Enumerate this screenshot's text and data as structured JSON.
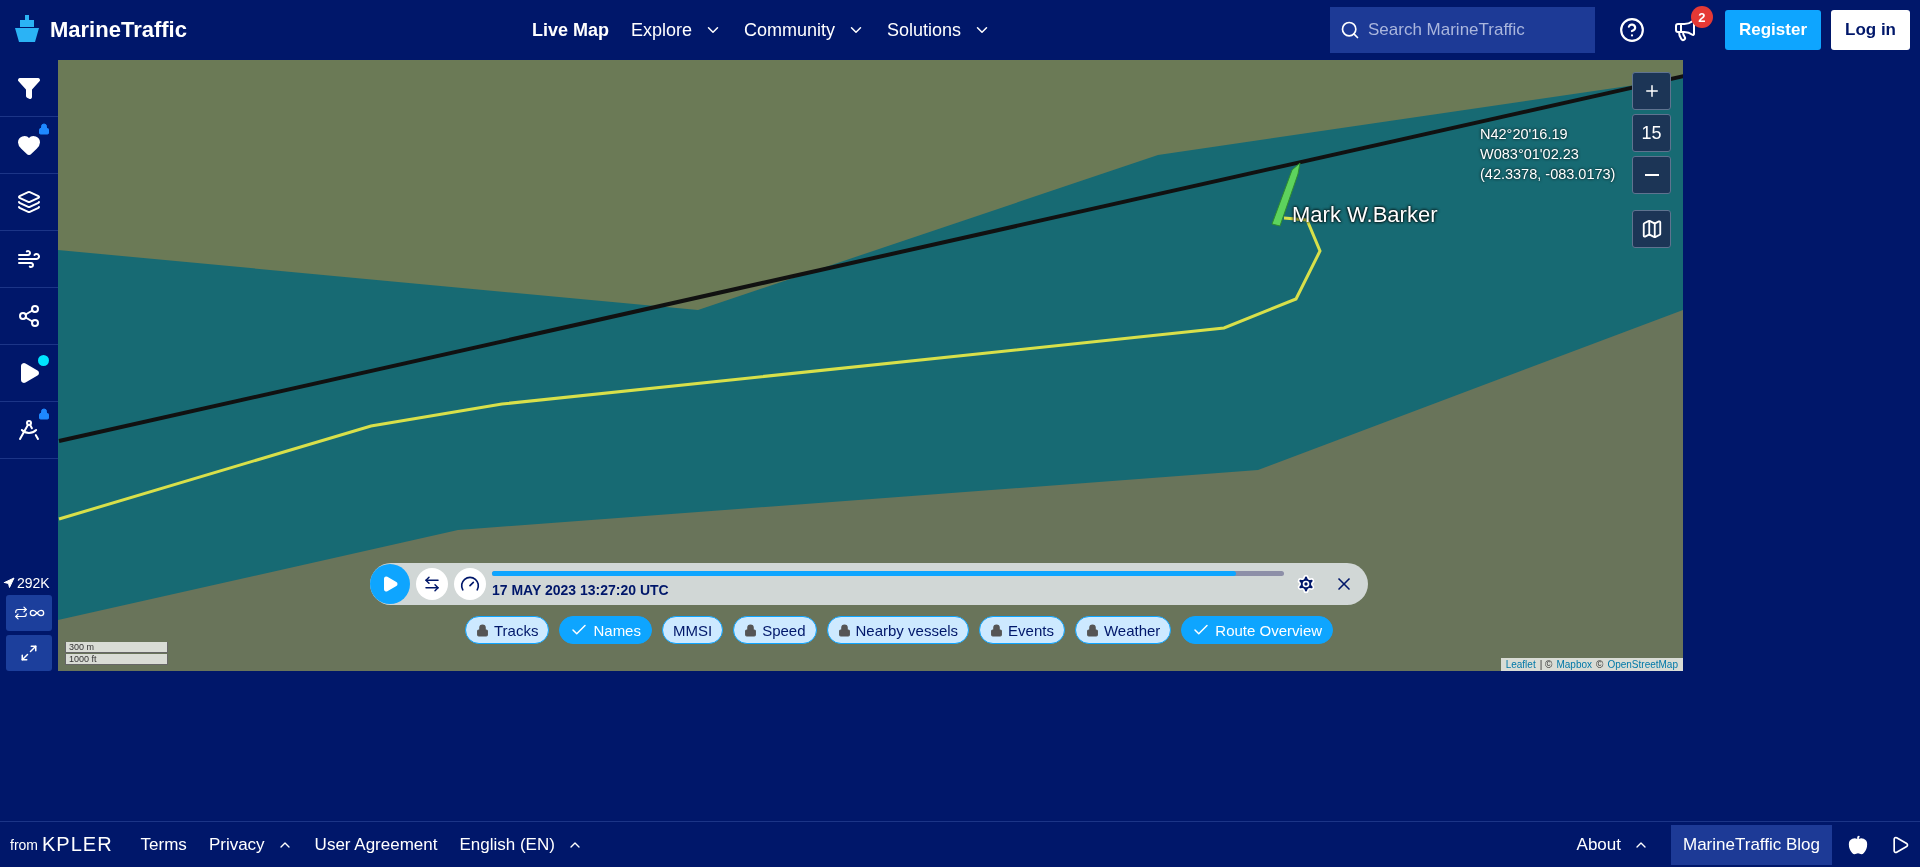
{
  "header": {
    "brand": "MarineTraffic",
    "nav": [
      {
        "label": "Live Map",
        "selected": true,
        "dropdown": false
      },
      {
        "label": "Explore",
        "selected": false,
        "dropdown": true
      },
      {
        "label": "Community",
        "selected": false,
        "dropdown": true
      },
      {
        "label": "Solutions",
        "selected": false,
        "dropdown": true
      }
    ],
    "search": {
      "placeholder": "Search MarineTraffic"
    },
    "notification_count": "2",
    "buttons": [
      {
        "label": "Register",
        "kind": "primary"
      },
      {
        "label": "Log in",
        "kind": "secondary"
      }
    ]
  },
  "sidebar": {
    "items": [
      {
        "kind": "filter",
        "locked": false,
        "notification": false
      },
      {
        "kind": "heart",
        "locked": true,
        "notification": false
      },
      {
        "kind": "layers",
        "locked": false,
        "notification": false
      },
      {
        "kind": "wind",
        "locked": false,
        "notification": false
      },
      {
        "kind": "network",
        "locked": false,
        "notification": false
      },
      {
        "kind": "play",
        "locked": false,
        "notification": true
      },
      {
        "kind": "compass",
        "locked": true,
        "notification": false
      }
    ],
    "vessel_count": "292K"
  },
  "map": {
    "vessel_name": "Mark W.Barker",
    "coordinates": [
      "N42°20'16.19",
      "W083°01'02.23",
      "(42.3378, -083.0173)"
    ],
    "zoom_level": "15",
    "scale": [
      "300 m",
      "1000 ft"
    ],
    "attribution": [
      {
        "kind": "link",
        "text": "Leaflet"
      },
      {
        "kind": "separator",
        "text": "| ©"
      },
      {
        "kind": "link",
        "text": "Mapbox"
      },
      {
        "kind": "separator",
        "text": "©"
      },
      {
        "kind": "link",
        "text": "OpenStreetMap"
      }
    ],
    "playback": {
      "timestamp": "17 MAY 2023 13:27:20 UTC",
      "level": 0.94
    },
    "chips": [
      {
        "label": "Tracks",
        "locked": true,
        "checked": false
      },
      {
        "label": "Names",
        "locked": false,
        "checked": true
      },
      {
        "label": "MMSI",
        "locked": false,
        "checked": false
      },
      {
        "label": "Speed",
        "locked": true,
        "checked": false
      },
      {
        "label": "Nearby vessels",
        "locked": true,
        "checked": false
      },
      {
        "label": "Events",
        "locked": true,
        "checked": false
      },
      {
        "label": "Weather",
        "locked": true,
        "checked": false
      },
      {
        "label": "Route Overview",
        "locked": false,
        "checked": true
      }
    ]
  },
  "footer": {
    "from": "from",
    "company": "KPLER",
    "links": [
      {
        "label": "Terms",
        "dropdown": false
      },
      {
        "label": "Privacy",
        "dropdown": true
      },
      {
        "label": "User Agreement",
        "dropdown": false
      },
      {
        "label": "English (EN)",
        "dropdown": true
      }
    ],
    "right_links": [
      {
        "label": "About",
        "dropdown": true
      }
    ],
    "blog": "MarineTraffic Blog"
  }
}
